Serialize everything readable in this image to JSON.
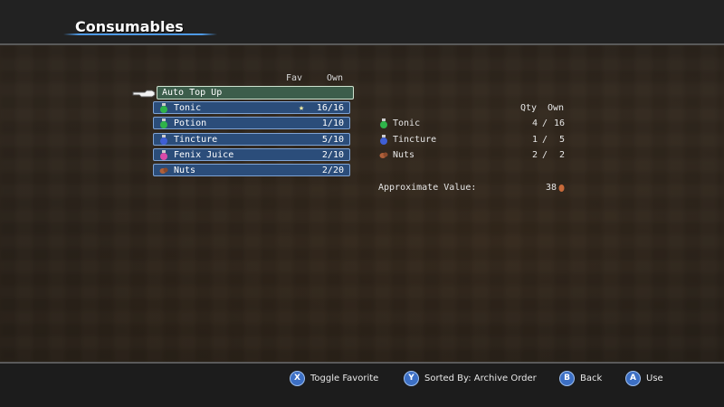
{
  "header": {
    "title": "Consumables"
  },
  "list": {
    "col_fav": "Fav",
    "col_own": "Own",
    "auto_top_up": "Auto Top Up",
    "items": [
      {
        "name": "Tonic",
        "own": "16/16",
        "fav": "★",
        "icon": "tonic-icon",
        "color": "#2fb34a"
      },
      {
        "name": "Potion",
        "own": "1/10",
        "fav": "",
        "icon": "potion-icon",
        "color": "#2fb34a"
      },
      {
        "name": "Tincture",
        "own": "5/10",
        "fav": "",
        "icon": "tincture-icon",
        "color": "#3f5fd6"
      },
      {
        "name": "Fenix Juice",
        "own": "2/10",
        "fav": "",
        "icon": "fenix-juice-icon",
        "color": "#d94aa8"
      },
      {
        "name": "Nuts",
        "own": "2/20",
        "fav": "",
        "icon": "nuts-icon",
        "color": "#b0603a"
      }
    ]
  },
  "summary": {
    "col_qty": "Qty",
    "col_own": "Own",
    "items": [
      {
        "name": "Tonic",
        "qty": "4",
        "own": "16",
        "icon": "tonic-icon"
      },
      {
        "name": "Tincture",
        "qty": "1",
        "own": "5",
        "icon": "tincture-icon"
      },
      {
        "name": "Nuts",
        "qty": "2",
        "own": "2",
        "icon": "nuts-icon"
      }
    ],
    "value_label": "Approximate Value:",
    "value": "38"
  },
  "footer": {
    "hints": [
      {
        "button": "X",
        "label": "Toggle Favorite"
      },
      {
        "button": "Y",
        "label": "Sorted By: Archive Order"
      },
      {
        "button": "B",
        "label": "Back"
      },
      {
        "button": "A",
        "label": "Use"
      }
    ]
  }
}
